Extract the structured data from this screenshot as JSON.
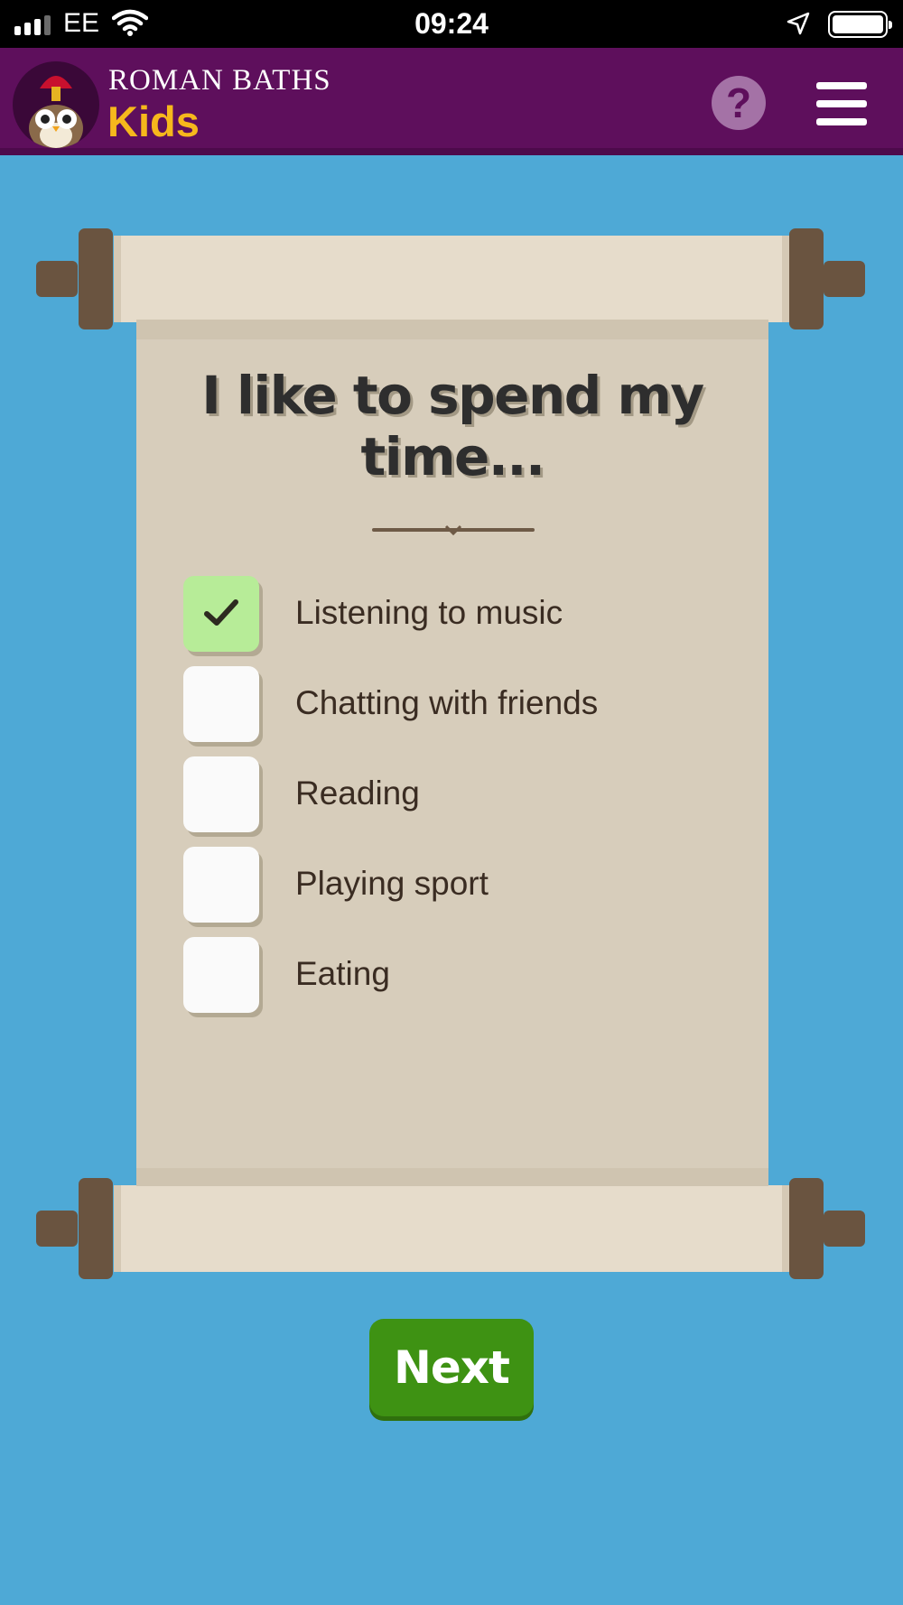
{
  "status_bar": {
    "carrier": "EE",
    "time": "09:24"
  },
  "header": {
    "title_line1": "ROMAN BATHS",
    "title_line2": "Kids",
    "help_label": "?",
    "colors": {
      "background": "#5e0f5c",
      "kids_text": "#f6b81c"
    }
  },
  "question": {
    "title": "I like to spend my time...",
    "options": [
      {
        "label": "Listening to music",
        "checked": true
      },
      {
        "label": "Chatting with friends",
        "checked": false
      },
      {
        "label": "Reading",
        "checked": false
      },
      {
        "label": "Playing sport",
        "checked": false
      },
      {
        "label": "Eating",
        "checked": false
      }
    ]
  },
  "footer": {
    "next_label": "Next",
    "colors": {
      "next_button": "#3e9213",
      "page_background": "#4ea9d6"
    }
  }
}
